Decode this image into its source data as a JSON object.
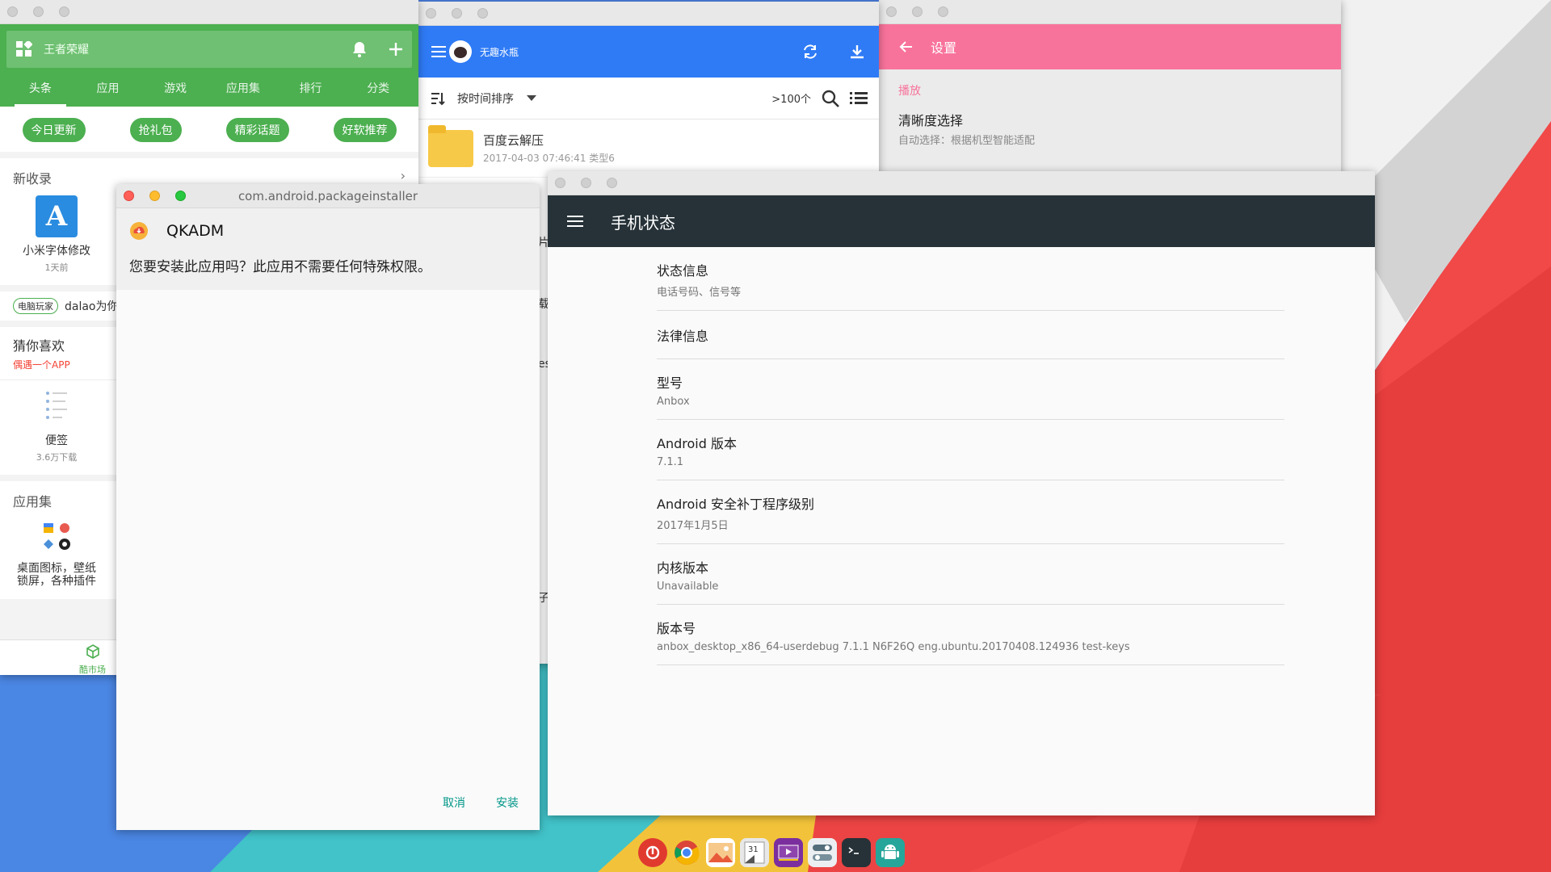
{
  "colors": {
    "coolapk_green": "#4caf50",
    "baidu_blue": "#2f7bf6",
    "settings_pink": "#f8739c",
    "status_dark": "#263238",
    "installer_teal": "#009688"
  },
  "coolapk": {
    "search_text": "王者荣耀",
    "tabs": [
      "头条",
      "应用",
      "游戏",
      "应用集",
      "排行",
      "分类"
    ],
    "chips": [
      "今日更新",
      "抢礼包",
      "精彩话题",
      "好软推荐"
    ],
    "new_section_title": "新收录",
    "new_app_name": "小米字体修改",
    "new_app_time": "1天前",
    "tag_badge": "电脑玩家",
    "tag_text": "dalao为你",
    "guess_title": "猜你喜欢",
    "guess_subtitle": "偶遇一个APP",
    "guess_app_name": "便签",
    "guess_app_downloads": "3.6万下载",
    "collection_title": "应用集",
    "collection_name": "桌面图标，壁纸锁屏，各种插件",
    "bottom_nav_label": "酷市场"
  },
  "baidu": {
    "username": "无趣水瓶",
    "sort_label": "按时间排序",
    "count": ">100个",
    "file_name": "百度云解压",
    "file_meta": "2017-04-03 07:46:41 类型6",
    "partial_letters": [
      "片",
      "载",
      "es",
      "子"
    ]
  },
  "settings": {
    "title": "设置",
    "section": "播放",
    "item_title": "清晰度选择",
    "item_subtitle": "自动选择：根据机型智能适配"
  },
  "installer": {
    "window_title": "com.android.packageinstaller",
    "app_name": "QKADM",
    "message": "您要安装此应用吗？此应用不需要任何特殊权限。",
    "cancel": "取消",
    "install": "安装"
  },
  "status": {
    "title": "手机状态",
    "items": [
      {
        "title": "状态信息",
        "subtitle": "电话号码、信号等"
      },
      {
        "title": "法律信息",
        "subtitle": ""
      },
      {
        "title": "型号",
        "subtitle": "Anbox"
      },
      {
        "title": "Android 版本",
        "subtitle": "7.1.1"
      },
      {
        "title": "Android 安全补丁程序级别",
        "subtitle": "2017年1月5日"
      },
      {
        "title": "内核版本",
        "subtitle": "Unavailable"
      },
      {
        "title": "版本号",
        "subtitle": "anbox_desktop_x86_64-userdebug 7.1.1 N6F26Q eng.ubuntu.20170408.124936 test-keys"
      }
    ]
  },
  "dock": [
    {
      "name": "netease-music-icon",
      "color": "#e03a2f"
    },
    {
      "name": "chrome-icon",
      "color": "#ffffff"
    },
    {
      "name": "photos-icon",
      "color": "#f05a3c"
    },
    {
      "name": "calendar-icon",
      "color": "#dcdcdc"
    },
    {
      "name": "video-icon",
      "color": "#7b2f9e"
    },
    {
      "name": "settings-toggle-icon",
      "color": "#546e7a"
    },
    {
      "name": "terminal-icon",
      "color": "#263238"
    },
    {
      "name": "android-icon",
      "color": "#26a69a"
    }
  ]
}
